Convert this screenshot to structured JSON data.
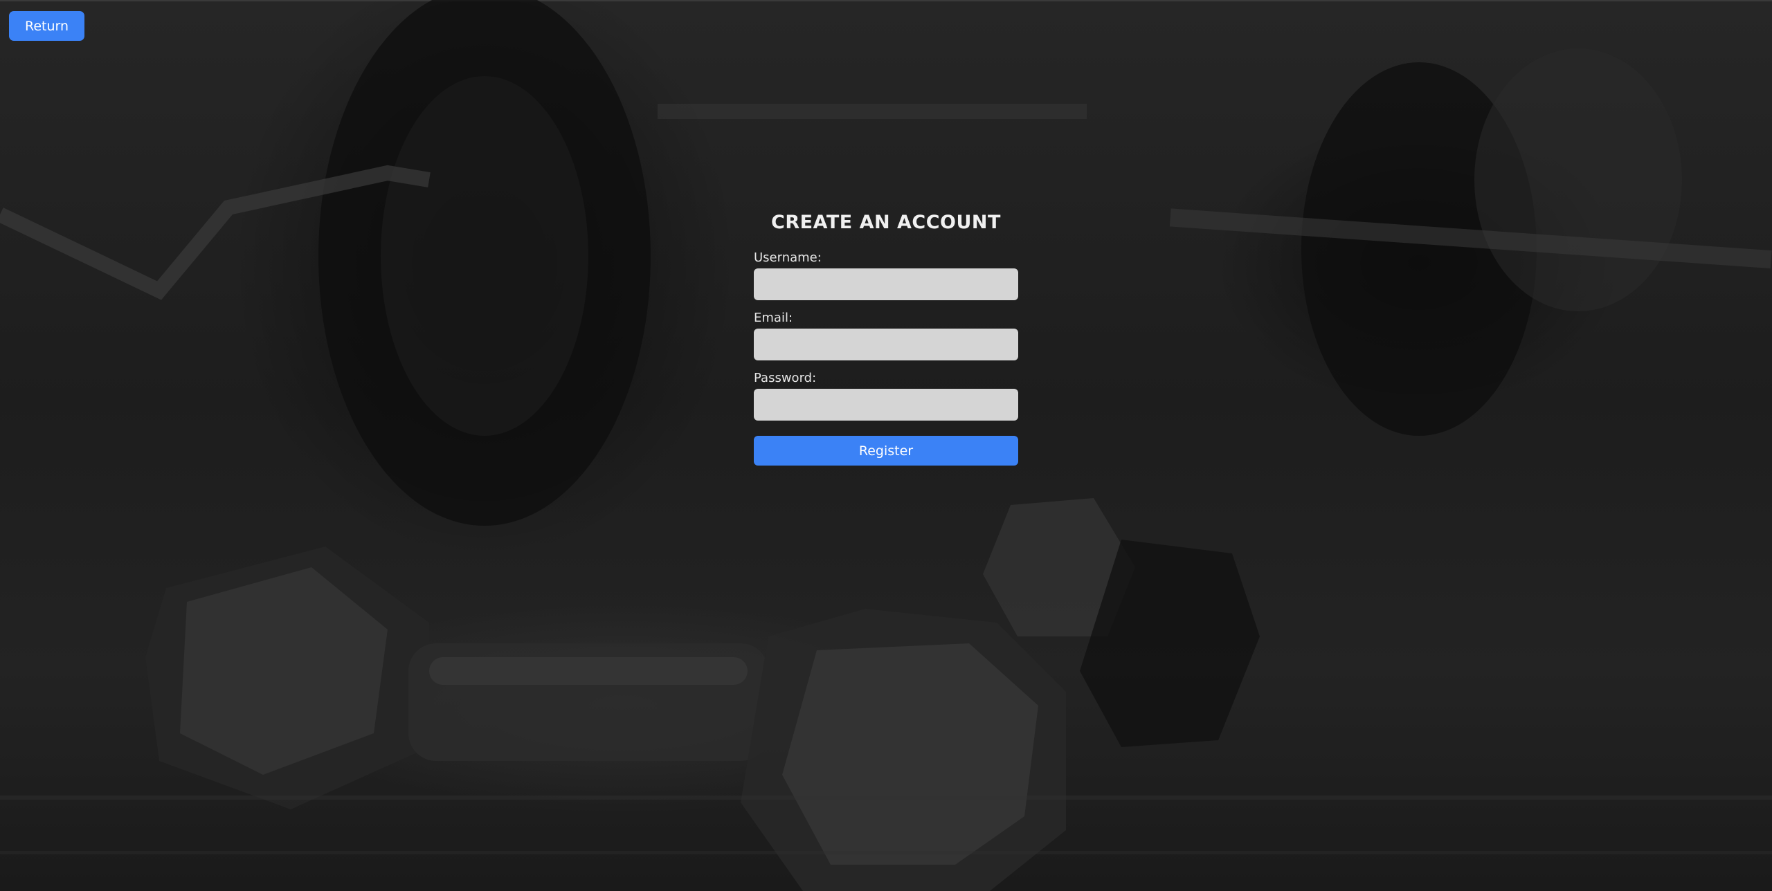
{
  "nav": {
    "return_label": "Return"
  },
  "form": {
    "title": "CREATE AN ACCOUNT",
    "fields": [
      {
        "label": "Username:",
        "value": "",
        "placeholder": ""
      },
      {
        "label": "Email:",
        "value": "",
        "placeholder": ""
      },
      {
        "label": "Password:",
        "value": "",
        "placeholder": ""
      }
    ],
    "submit_label": "Register"
  },
  "colors": {
    "accent": "#3b82f6",
    "input_background": "#d5d5d5",
    "page_background": "#1f1f1f",
    "text": "#f0f0f0"
  }
}
